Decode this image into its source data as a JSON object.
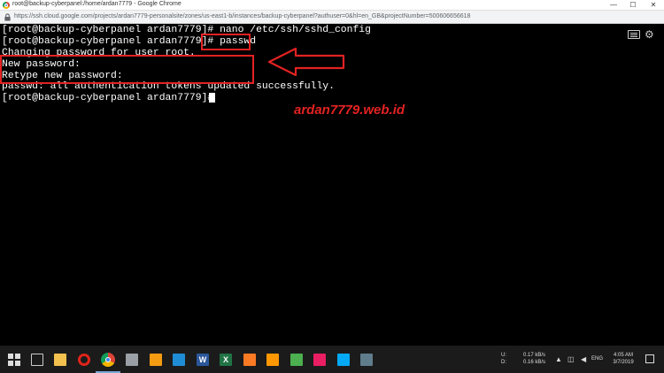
{
  "window": {
    "title": "root@backup-cyberpanel:/home/ardan7779 - Google Chrome",
    "minimize": "—",
    "maximize": "☐",
    "close": "✕"
  },
  "address_bar": {
    "url": "https://ssh.cloud.google.com/projects/ardan7779-personalsite/zones/us-east1-b/instances/backup-cyberpanel?authuser=0&hl=en_GB&projectNumber=500606656618"
  },
  "terminal": {
    "lines": [
      "[root@backup-cyberpanel ardan7779]# nano /etc/ssh/sshd_config",
      "[root@backup-cyberpanel ardan7779]# passwd",
      "Changing password for user root.",
      "New password:",
      "Retype new password:",
      "passwd: all authentication tokens updated successfully.",
      "[root@backup-cyberpanel ardan7779]#"
    ],
    "highlight_color": "#e32222"
  },
  "watermark": "ardan7779.web.id",
  "taskbar": {
    "word_label": "W",
    "excel_label": "X",
    "network_labels": {
      "up": "U:",
      "down": "D:"
    },
    "network_values": {
      "up": "0.17 kB/s",
      "down": "0.16 kB/s"
    },
    "language": "ENG",
    "time": "4:05 AM",
    "date": "3/7/2019"
  },
  "icons": [
    "chrome-icon",
    "lock-icon",
    "keyboard-icon",
    "gear-icon",
    "windows-start-icon",
    "task-view-icon",
    "file-explorer-icon",
    "opera-icon",
    "word-icon",
    "excel-icon",
    "xampp-icon",
    "sublime-text-icon"
  ]
}
